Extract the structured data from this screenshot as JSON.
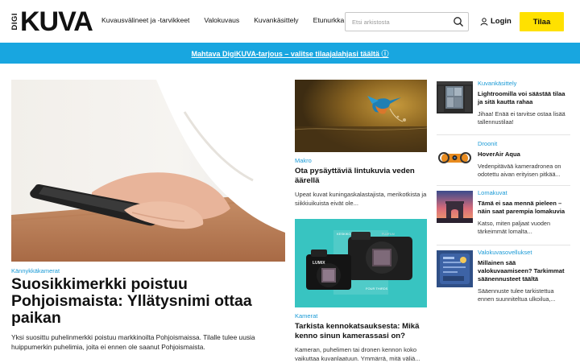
{
  "header": {
    "logo_small": "DIGI",
    "logo_big": "KUVA",
    "nav": [
      "Kuvausvälineet ja -tarvikkeet",
      "Valokuvaus",
      "Kuvankäsittely",
      "Etunurkka"
    ],
    "search_placeholder": "Etsi arkistosta",
    "login_label": "Login",
    "subscribe_label": "Tilaa",
    "accent_color": "#ffe100"
  },
  "promo": {
    "text": "Mahtava DigiKUVA-tarjous – valitse tilaajalahjasi täältä ⓘ",
    "color": "#18a6e0"
  },
  "hero": {
    "category": "Kännykkäkamerat",
    "title": "Suosikkimerkki poistuu Pohjoismaista: Yllätysnimi ottaa paikan",
    "summary": "Yksi suosittu puhelinmerkki poistuu markkinoilta Pohjoismaissa. Tilalle tulee uusia huippumerkin puhelimia, joita ei ennen ole saanut Pohjoismaista."
  },
  "middle": [
    {
      "category": "Makro",
      "title": "Ota pysäyttäviä lintukuvia veden äärellä",
      "summary": "Upeat kuvat kuningaskalastajista, merikotkista ja siikkiuikuista eivät ole..."
    },
    {
      "category": "Kamerat",
      "title": "Tarkista kennokatsauksesta: Mikä kenno sinun kamerassasi on?",
      "summary": "Kameran, puhelimen tai dronen kennon koko vaikuttaa kuvanlaatuun. Ymmärrä, mitä väliä...",
      "box_label_left": "KESKIKOKO",
      "box_label_right": "FOUR THIRDS",
      "camera_brand_left": "LUMIX",
      "camera_brand_right": "FUJIFILM"
    }
  ],
  "side": [
    {
      "category": "Kuvankäsittely",
      "title": "Lightroomilla voi säästää tilaa ja sitä kautta rahaa",
      "summary": "Jihaa! Enää ei tarvitse ostaa lisää tallennustilaa!"
    },
    {
      "category": "Droonit",
      "title": "HoverAir Aqua",
      "summary": "Vedenpitävää kameradronea on odotettu aivan erityisen pitkää..."
    },
    {
      "category": "Lomakuvat",
      "title": "Tämä ei saa mennä pieleen – näin saat parempia lomakuvia",
      "summary": "Katso, miten paljaat vuoden tärkeimmät lomalta..."
    },
    {
      "category": "Valokuvasovellukset",
      "title": "Millainen sää valokuvaamiseen? Tarkimmat säänennusteet täältä",
      "summary": "Sääennuste tulee tarkistettua ennen suunniteltua ulkoilua,..."
    }
  ]
}
